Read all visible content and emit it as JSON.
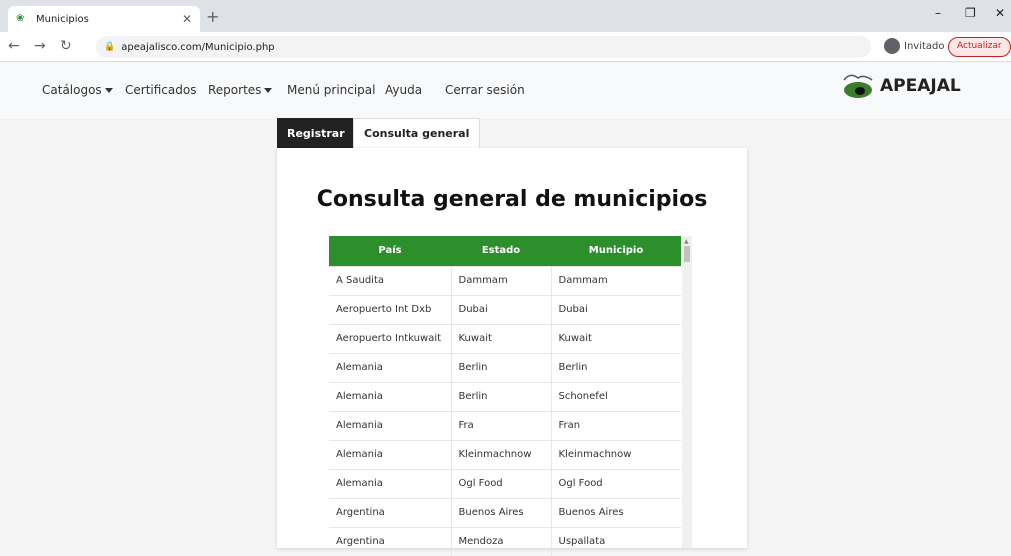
{
  "browser": {
    "tab_title": "Municipios",
    "url": "apeajalisco.com/Municipio.php",
    "profile_label": "Invitado",
    "update_label": "Actualizar"
  },
  "nav": {
    "catalogos": "Catálogos",
    "certificados": "Certificados",
    "reportes": "Reportes",
    "menu": "Menú principal",
    "ayuda": "Ayuda",
    "cerrar": "Cerrar sesión",
    "logo": "APEAJAL"
  },
  "tabs": {
    "registrar": "Registrar",
    "consulta": "Consulta general"
  },
  "page": {
    "title": "Consulta general de municipios"
  },
  "table": {
    "headers": [
      "País",
      "Estado",
      "Municipio"
    ],
    "rows": [
      [
        "A Saudita",
        "Dammam",
        "Dammam"
      ],
      [
        "Aeropuerto Int Dxb",
        "Dubai",
        "Dubai"
      ],
      [
        "Aeropuerto Intkuwait",
        "Kuwait",
        "Kuwait"
      ],
      [
        "Alemania",
        "Berlin",
        "Berlin"
      ],
      [
        "Alemania",
        "Berlin",
        "Schonefel"
      ],
      [
        "Alemania",
        "Fra",
        "Fran"
      ],
      [
        "Alemania",
        "Kleinmachnow",
        "Kleinmachnow"
      ],
      [
        "Alemania",
        "Ogl Food",
        "Ogl Food"
      ],
      [
        "Argentina",
        "Buenos Aires",
        "Buenos Aires"
      ],
      [
        "Argentina",
        "Mendoza",
        "Uspallata"
      ]
    ]
  },
  "colors": {
    "header_green": "#2c8f2c",
    "dark_tab": "#222222"
  }
}
